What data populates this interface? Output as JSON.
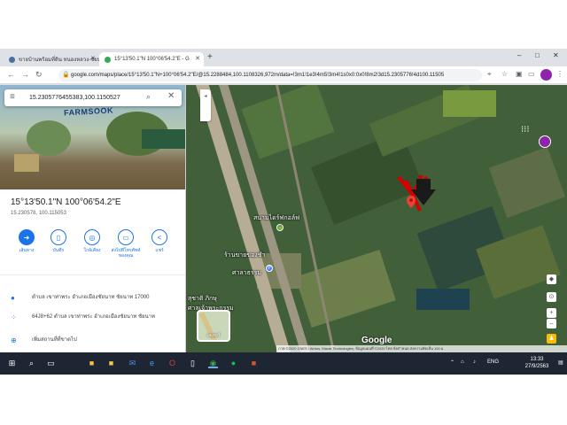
{
  "browser": {
    "tabs": [
      {
        "title": "ขายบ้านพร้อมที่ดิน หนองหลวง-ชัยนาท",
        "favicon_color": "#4a6fa5",
        "active": false
      },
      {
        "title": "15°13'50.1\"N 100°06'54.2\"E - G",
        "favicon_color": "#34a853",
        "active": true
      }
    ],
    "new_tab_label": "+",
    "window_controls": [
      "–",
      "□",
      "✕"
    ],
    "address": "google.com/maps/place/15°13'50.1\"N+100°06'54.2\"E/@15.2288484,100.1108326,972m/data=!3m1!1e3!4m5!3m4!1s0x0:0x0!8m2!3d15.2305776!4d100.11505"
  },
  "maps": {
    "search_value": "15.2305776455383,100.1150527",
    "photo_sign": "FARMSOOK",
    "place_title": "15°13'50.1\"N 100°06'54.2\"E",
    "place_subtitle": "15.230578, 100.115053",
    "actions": [
      {
        "label": "เส้นทาง",
        "icon": "directions-icon",
        "glyph": "➜"
      },
      {
        "label": "บันทึก",
        "icon": "bookmark-icon",
        "glyph": "▯"
      },
      {
        "label": "ใกล้เคียง",
        "icon": "nearby-icon",
        "glyph": "◎"
      },
      {
        "label": "ส่งไปที่โทรศัพท์ของคุณ",
        "icon": "send-to-phone-icon",
        "glyph": "▭"
      },
      {
        "label": "แชร์",
        "icon": "share-icon",
        "glyph": "<"
      }
    ],
    "info_rows": [
      {
        "icon": "pin-icon",
        "glyph": "●",
        "text": "ตำบล เขาท่าพระ อำเภอเมืองชัยนาท ชัยนาท 17000"
      },
      {
        "icon": "plus-code-icon",
        "glyph": "⁘",
        "text": "64J8+62 ตำบล เขาท่าพระ อำเภอเมืองชัยนาท ชัยนาท"
      },
      {
        "icon": "add-place-icon",
        "glyph": "⊕",
        "text": "เพิ่มสถานที่ที่ขาดไป"
      }
    ],
    "map_labels": [
      {
        "text": "สนามไดร์ฟกอล์ฟ"
      },
      {
        "text": "ร้านขายของชำ"
      },
      {
        "text": "ศาลาธรรม"
      },
      {
        "text": "สุชาติ ภิกษุ"
      },
      {
        "text": "ศาลเจ้าพระกรรม"
      }
    ],
    "layers_label": "เลเยอร์",
    "google_logo": "Google",
    "attribution": "ภาพ ©2020 CNES / Airbus, Maxar Technologies, ข้อมูลแผนที่ ©2020  ไทย  ข้อกำหนด  ส่งความคิดเห็น  100 ม."
  },
  "taskbar": {
    "time": "13:33",
    "date": "27/9/2563",
    "lang": "ENG",
    "apps": [
      {
        "name": "windows-start-icon",
        "glyph": "⊞",
        "color": "#ffffff"
      },
      {
        "name": "search-icon",
        "glyph": "⌕",
        "color": "#ffffff"
      },
      {
        "name": "task-view-icon",
        "glyph": "▭",
        "color": "#ffffff"
      },
      {
        "name": "file-explorer-icon",
        "glyph": "■",
        "color": "#f5c242"
      },
      {
        "name": "store-icon",
        "glyph": "■",
        "color": "#f2c94c"
      },
      {
        "name": "mail-icon",
        "glyph": "✉",
        "color": "#4a90e2"
      },
      {
        "name": "edge-icon",
        "glyph": "e",
        "color": "#3ba0e6"
      },
      {
        "name": "opera-icon",
        "glyph": "O",
        "color": "#e0383e"
      },
      {
        "name": "document-icon",
        "glyph": "▯",
        "color": "#ffffff"
      },
      {
        "name": "chrome-icon",
        "glyph": "◉",
        "color": "#34a853"
      },
      {
        "name": "line-icon",
        "glyph": "●",
        "color": "#06c755"
      },
      {
        "name": "powerpoint-icon",
        "glyph": "■",
        "color": "#d9552f"
      }
    ]
  },
  "colors": {
    "accent": "#1a73e8",
    "marker": "#ea4335",
    "annotation_arrow": "#d40000"
  }
}
